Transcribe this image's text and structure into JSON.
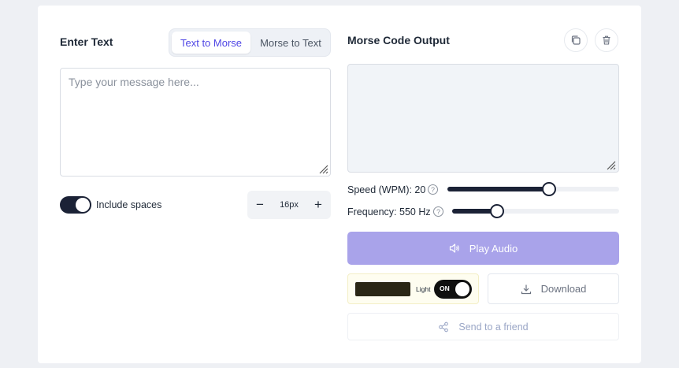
{
  "input": {
    "title": "Enter Text",
    "placeholder": "Type your message here...",
    "value": ""
  },
  "mode": {
    "active": "Text to Morse",
    "inactive": "Morse to Text"
  },
  "options": {
    "include_spaces_label": "Include spaces",
    "include_spaces_on": true,
    "font_size": "16px",
    "decrease": "−",
    "increase": "+"
  },
  "output": {
    "title": "Morse Code Output",
    "value": "",
    "copy_icon": "copy-icon",
    "delete_icon": "trash-icon"
  },
  "speed": {
    "label": "Speed (WPM): 20",
    "help": "?",
    "level": 0.59
  },
  "frequency": {
    "label": "Frequency: 550 Hz",
    "help": "?",
    "level": 0.27
  },
  "actions": {
    "play": "Play Audio",
    "download": "Download",
    "share": "Send to a friend"
  },
  "theme": {
    "light_label": "Light",
    "toggle_state": "ON",
    "swatch_color": "#2a2615"
  },
  "colors": {
    "accent": "#4f46e5",
    "play_button": "#a9a3ea",
    "dark": "#1b2236"
  }
}
